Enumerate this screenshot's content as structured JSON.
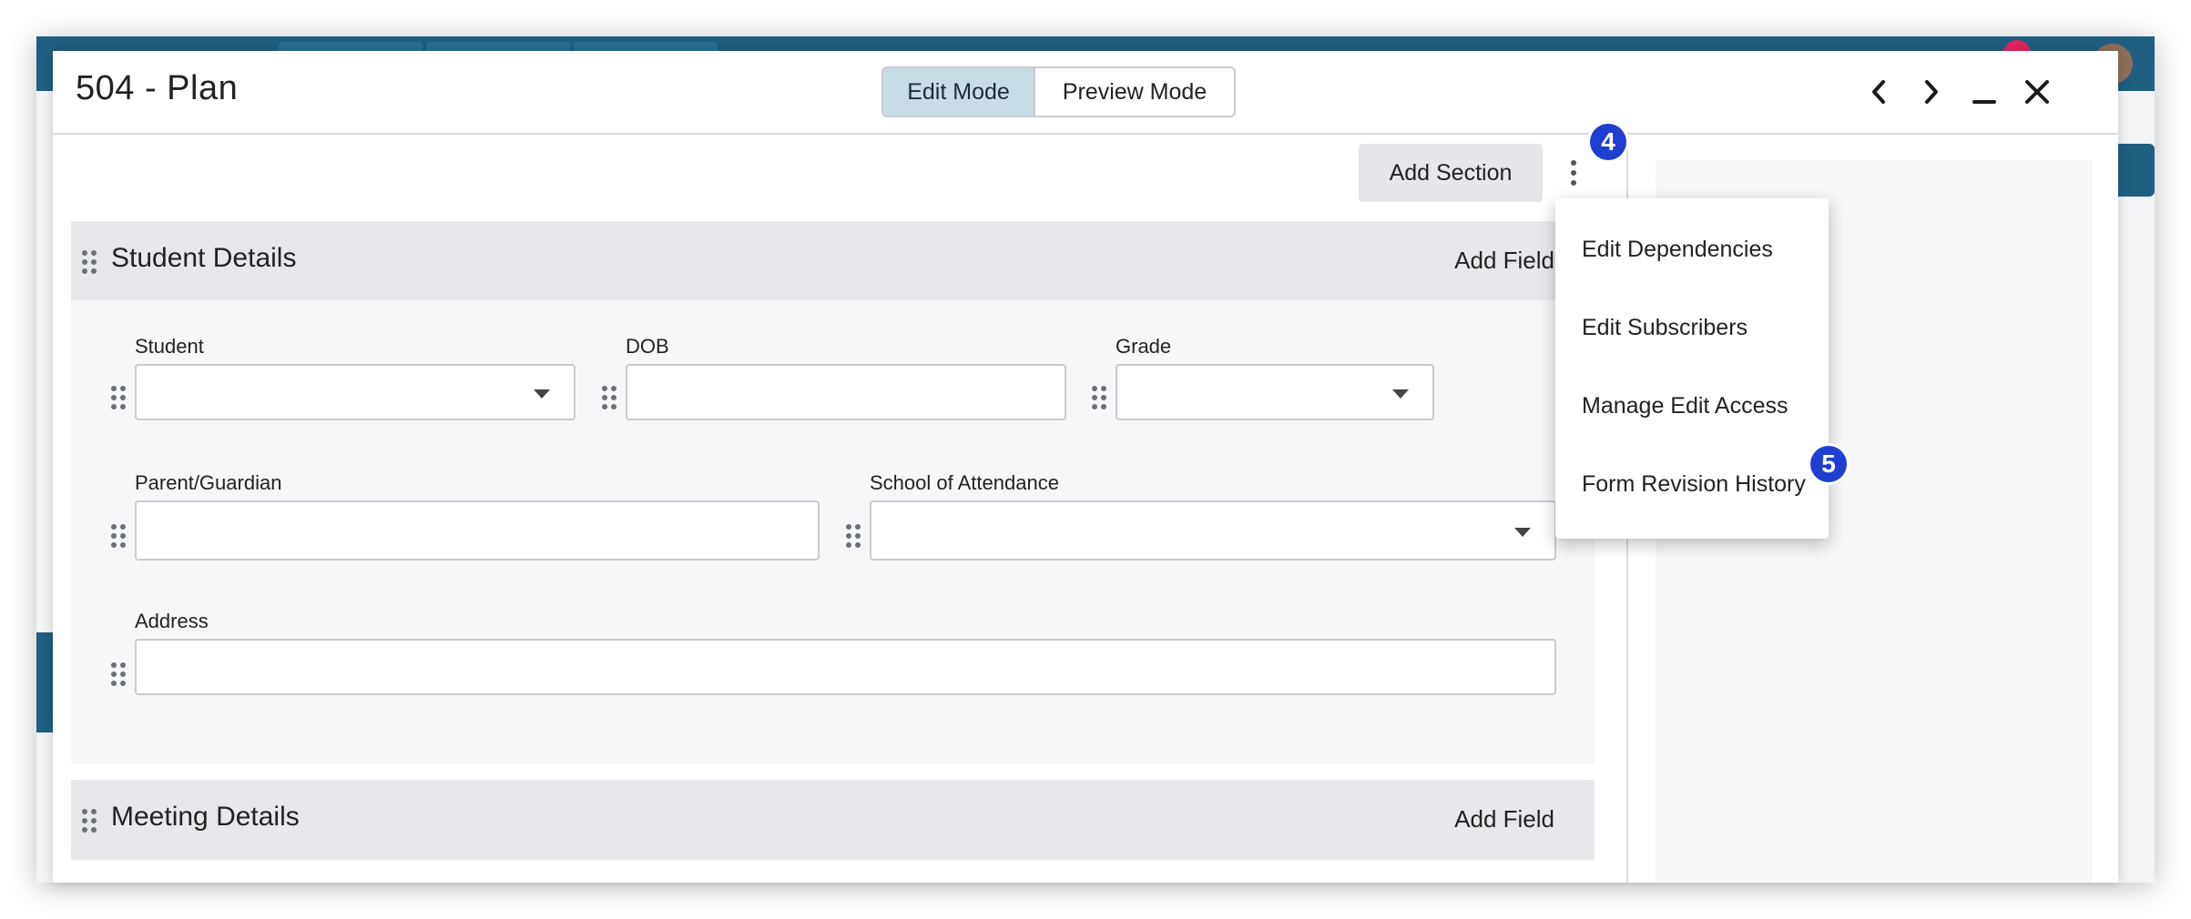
{
  "modal": {
    "title": "504 - Plan",
    "mode_toggle": {
      "edit_label": "Edit Mode",
      "preview_label": "Preview Mode",
      "selected": "Edit Mode"
    },
    "header_icons": [
      "chevron-left-icon",
      "chevron-right-icon",
      "minimize-icon",
      "close-icon"
    ]
  },
  "toolbar": {
    "add_section_label": "Add Section",
    "more_menu_icon": "kebab-icon",
    "step_marker": "4"
  },
  "more_menu": {
    "items": [
      "Edit Dependencies",
      "Edit Subscribers",
      "Manage Edit Access",
      "Form Revision History"
    ],
    "step_marker": "5"
  },
  "sections": [
    {
      "title": "Student Details",
      "add_field_label": "Add Field",
      "fields": [
        {
          "label": "Student",
          "type": "select",
          "value": ""
        },
        {
          "label": "DOB",
          "type": "text",
          "value": ""
        },
        {
          "label": "Grade",
          "type": "select",
          "value": ""
        },
        {
          "label": "Parent/Guardian",
          "type": "text",
          "value": ""
        },
        {
          "label": "School of Attendance",
          "type": "select",
          "value": ""
        },
        {
          "label": "Address",
          "type": "text",
          "value": ""
        }
      ]
    },
    {
      "title": "Meeting Details",
      "add_field_label": "Add Field",
      "fields": []
    }
  ],
  "background": {
    "notification_count": "1"
  },
  "colors": {
    "accent_dark": "#1f5f80",
    "edit_mode_active": "#c8dce6",
    "step_marker": "#1f3fd0",
    "section_header": "#e7e8ec"
  }
}
